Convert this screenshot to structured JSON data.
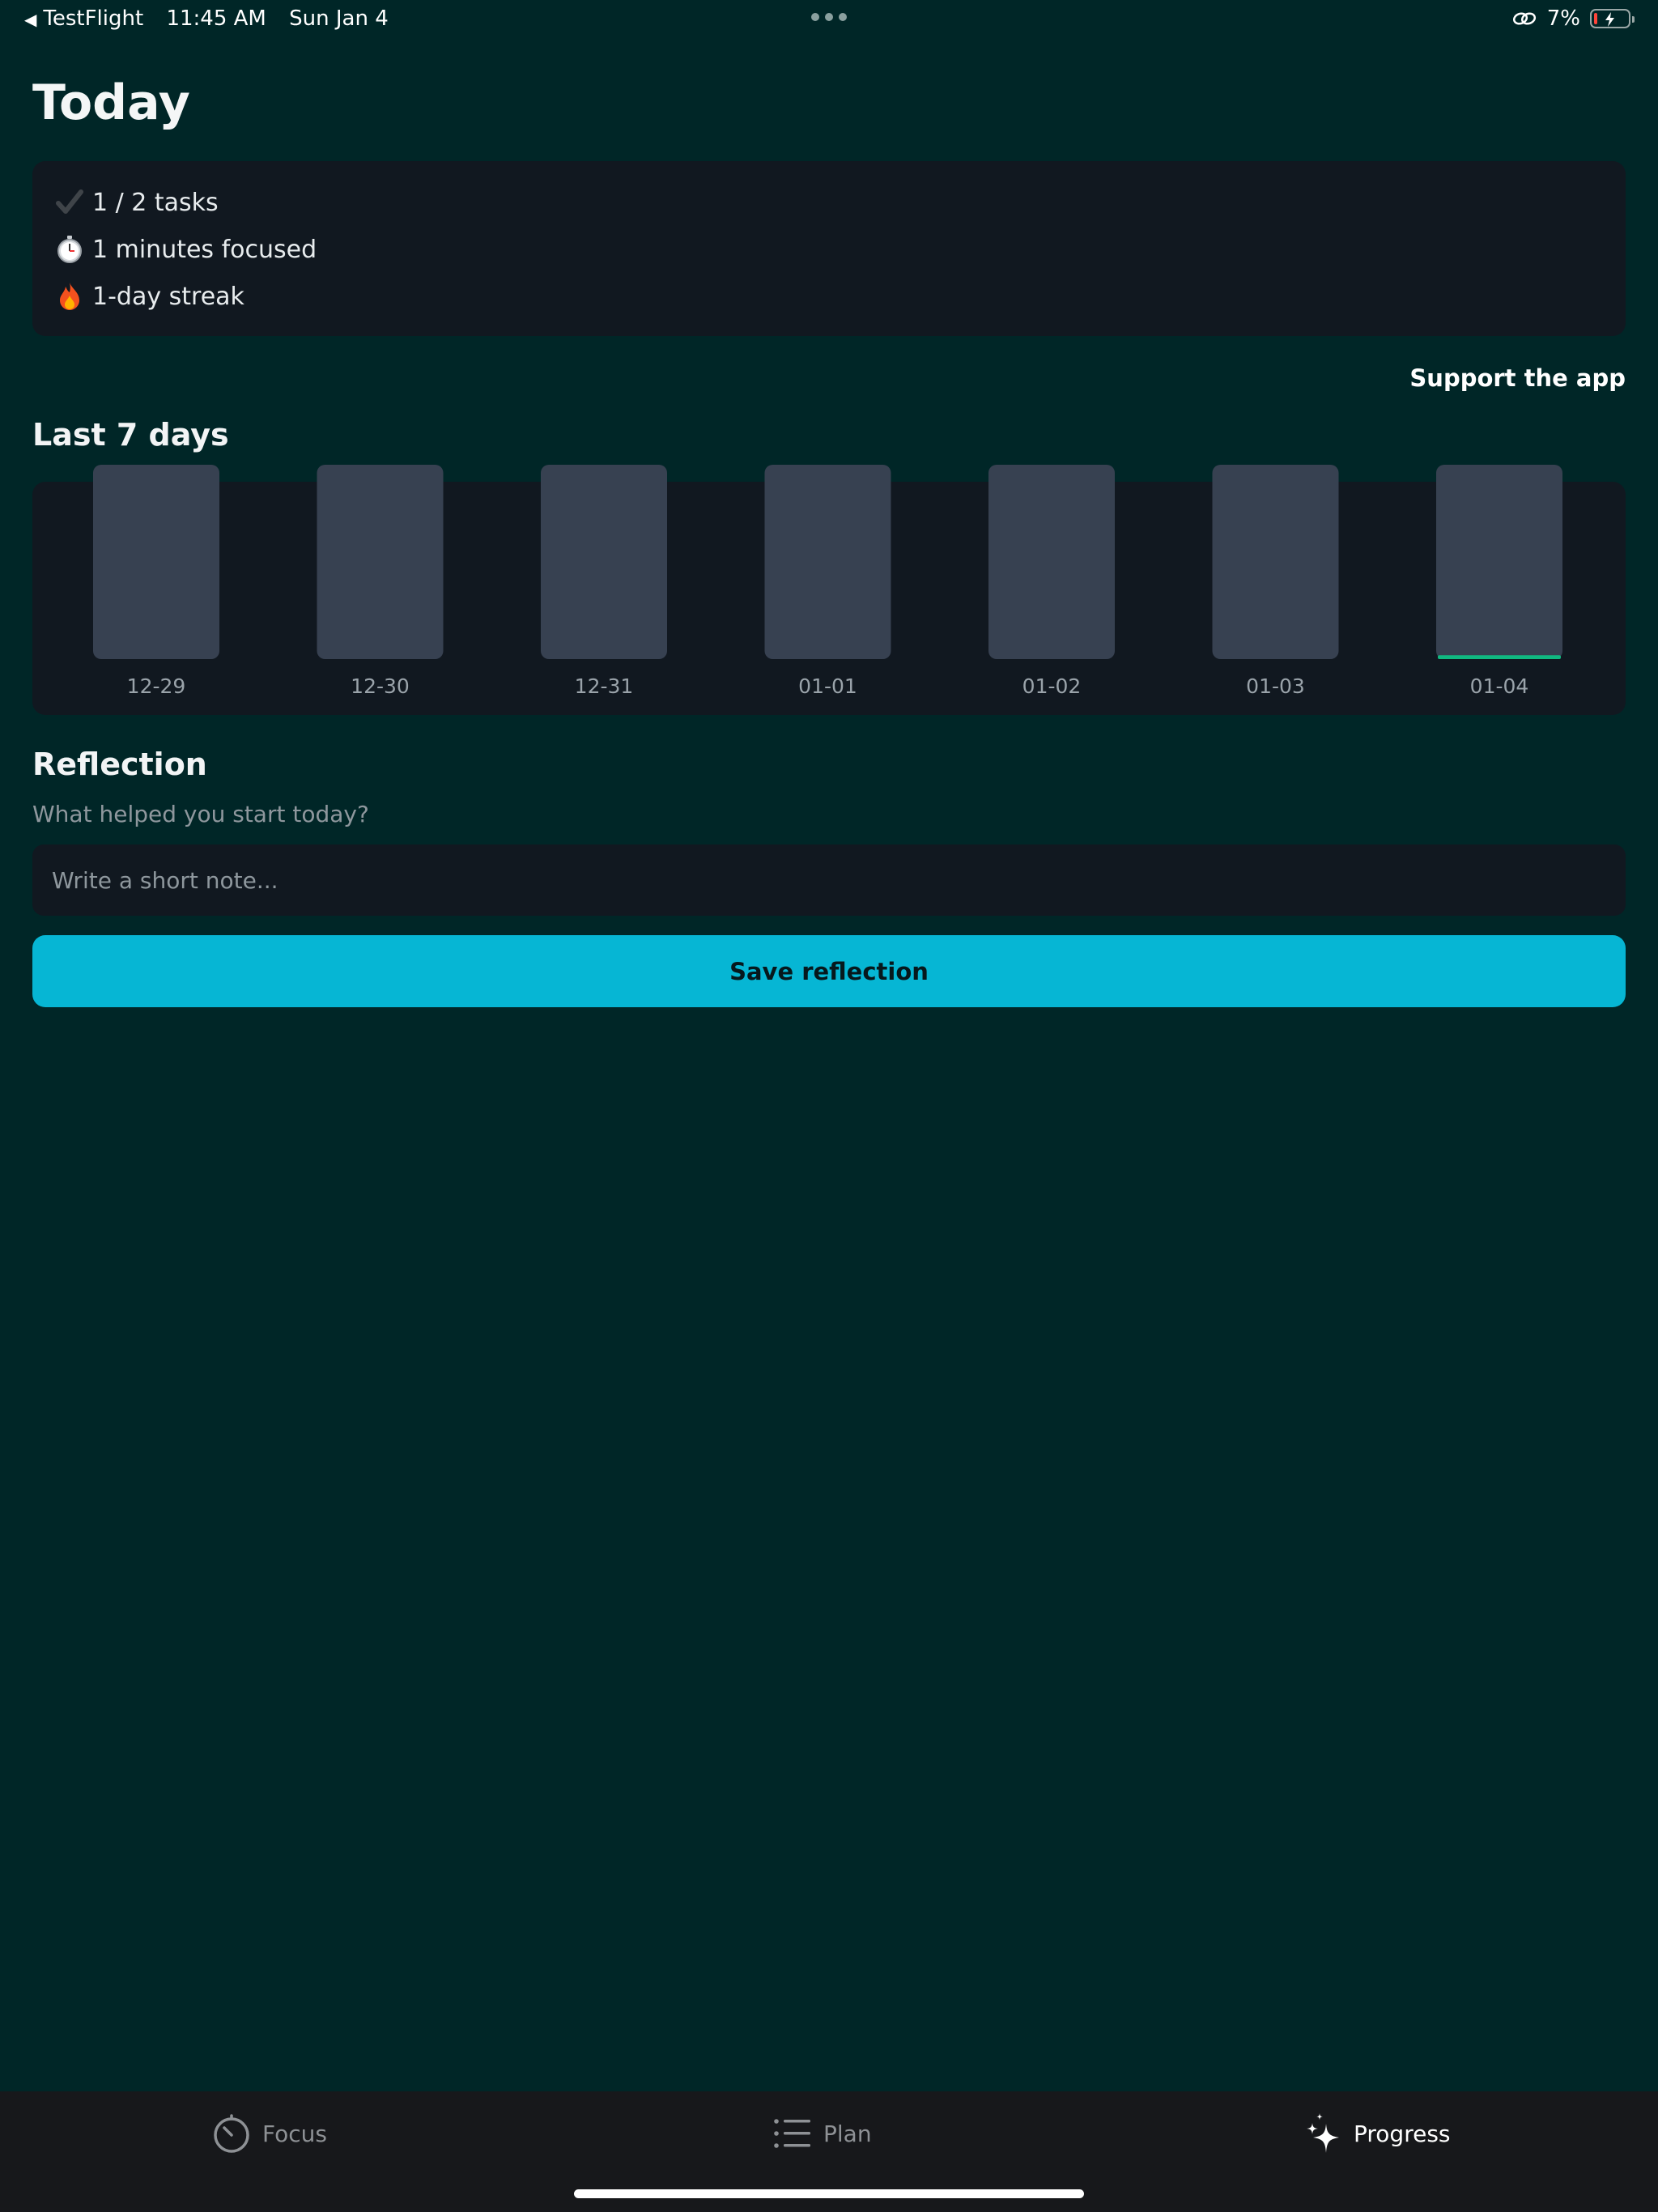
{
  "status_bar": {
    "back_app": "TestFlight",
    "time": "11:45 AM",
    "date": "Sun Jan 4",
    "battery": "7%"
  },
  "page": {
    "title": "Today"
  },
  "summary": {
    "tasks": "1 / 2 tasks",
    "focused": "1 minutes focused",
    "streak": "1-day streak"
  },
  "support": {
    "label": "Support the app"
  },
  "last7": {
    "title": "Last 7 days"
  },
  "chart_data": {
    "type": "bar",
    "categories": [
      "12-29",
      "12-30",
      "12-31",
      "01-01",
      "01-02",
      "01-03",
      "01-04"
    ],
    "values": [
      0,
      0,
      0,
      0,
      0,
      0,
      0.02
    ],
    "ylim": [
      0,
      1
    ],
    "track_color": "#374151",
    "fill_color": "#10b981",
    "grid": false
  },
  "reflection": {
    "title": "Reflection",
    "prompt": "What helped you start today?",
    "placeholder": "Write a short note...",
    "value": "",
    "save_label": "Save reflection"
  },
  "tabs": [
    {
      "label": "Focus",
      "icon": "timer-icon",
      "active": false
    },
    {
      "label": "Plan",
      "icon": "list-icon",
      "active": false
    },
    {
      "label": "Progress",
      "icon": "sparkles-icon",
      "active": true
    }
  ],
  "colors": {
    "background": "#002627",
    "card": "#111820",
    "accent": "#06b6d4"
  }
}
